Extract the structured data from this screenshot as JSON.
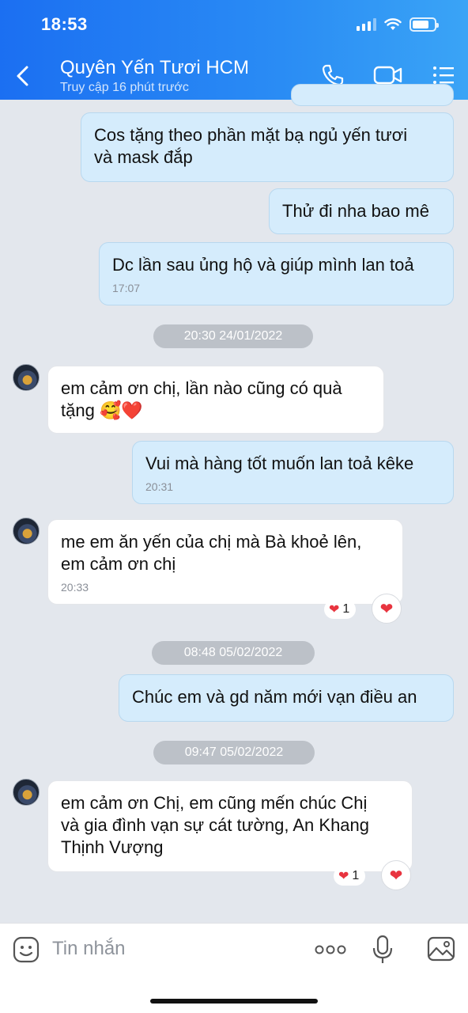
{
  "status": {
    "time": "18:53"
  },
  "header": {
    "title": "Quyên Yến Tươi HCM",
    "subtitle": "Truy cập 16 phút trước"
  },
  "messages": [
    {
      "dir": "out",
      "text_lines": [
        "Cos tặng theo phần mặt bạ ngủ yến tươi",
        "và mask đắp"
      ]
    },
    {
      "dir": "out",
      "text_lines": [
        "Thử đi nha bao mê"
      ]
    },
    {
      "dir": "out",
      "text_lines": [
        "Dc lần sau ủng hộ và giúp mình lan toả"
      ],
      "time": "17:07"
    },
    {
      "separator": "20:30 24/01/2022"
    },
    {
      "dir": "in",
      "text_lines": [
        "em cảm ơn chị, lần nào cũng có quà",
        "tặng"
      ],
      "emoji": "🥰❤️"
    },
    {
      "dir": "out",
      "text_lines": [
        "Vui mà hàng tốt muốn lan toả kêke"
      ],
      "time": "20:31"
    },
    {
      "dir": "in",
      "text_lines": [
        "me em ăn yến của chị mà Bà khoẻ lên,",
        "em cảm ơn chị"
      ],
      "time": "20:33",
      "reaction_count": "1"
    },
    {
      "separator": "08:48 05/02/2022"
    },
    {
      "dir": "out",
      "text_lines": [
        "Chúc em và gd năm mới vạn điều an"
      ]
    },
    {
      "separator": "09:47 05/02/2022"
    },
    {
      "dir": "in",
      "text_lines": [
        "em cảm ơn Chị, em cũng mến chúc Chị",
        "và gia đình vạn sự cát tường, An Khang",
        "Thịnh Vượng"
      ],
      "reaction_count": "1"
    }
  ],
  "input": {
    "placeholder": "Tin nhắn"
  },
  "icons": {
    "back": "back-arrow-icon",
    "call": "phone-icon",
    "video": "video-camera-icon",
    "menu": "list-menu-icon",
    "sticker": "sticker-icon",
    "more": "more-dots-icon",
    "mic": "microphone-icon",
    "image": "image-icon",
    "reaction": "heart-icon"
  },
  "colors": {
    "header": "#1b6ff2",
    "outgoing_bubble": "#d5ecfc",
    "incoming_bubble": "#ffffff",
    "heart": "#e8343f"
  }
}
